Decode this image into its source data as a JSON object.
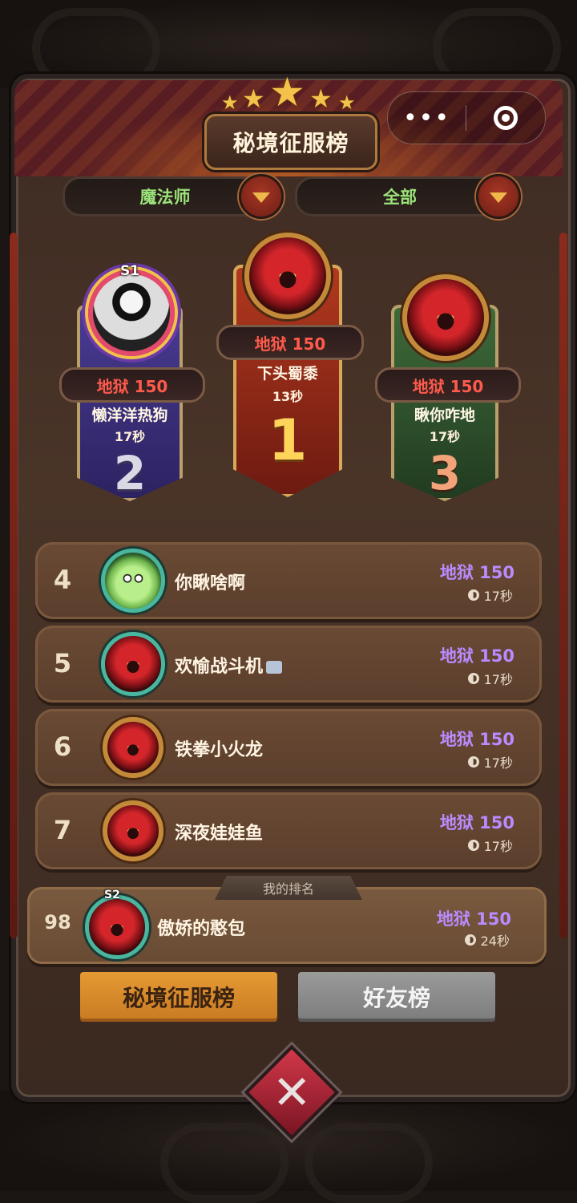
{
  "header": {
    "title": "秘境征服榜",
    "capsule": {
      "more_icon": "more-dots-icon",
      "close_icon": "target-close-icon"
    }
  },
  "filters": {
    "class_filter": "魔法师",
    "scope_filter": "全部"
  },
  "podium": [
    {
      "rank": "2",
      "badge": "S1",
      "level": "地狱 150",
      "name": "懒洋洋热狗",
      "time": "17秒"
    },
    {
      "rank": "1",
      "badge": "",
      "level": "地狱 150",
      "name": "下头蜀黍",
      "time": "13秒"
    },
    {
      "rank": "3",
      "badge": "",
      "level": "地狱 150",
      "name": "瞅你咋地",
      "time": "17秒"
    }
  ],
  "list": [
    {
      "rank": "4",
      "name": "你瞅啥啊",
      "level": "地狱 150",
      "time": "17秒"
    },
    {
      "rank": "5",
      "name": "欢愉战斗机",
      "level": "地狱 150",
      "time": "17秒"
    },
    {
      "rank": "6",
      "name": "铁拳小火龙",
      "level": "地狱 150",
      "time": "17秒"
    },
    {
      "rank": "7",
      "name": "深夜娃娃鱼",
      "level": "地狱 150",
      "time": "17秒"
    }
  ],
  "my_rank": {
    "tab_label": "我的排名",
    "rank": "98",
    "badge": "S2",
    "name": "傲娇的憨包",
    "level": "地狱 150",
    "time": "24秒"
  },
  "tabs": {
    "conquest": "秘境征服榜",
    "friends": "好友榜"
  },
  "colors": {
    "level_text_list": "#b98bff",
    "level_text_podium": "#ff5a4c",
    "filter_text": "#9be27a",
    "active_tab": "#e59a34"
  }
}
